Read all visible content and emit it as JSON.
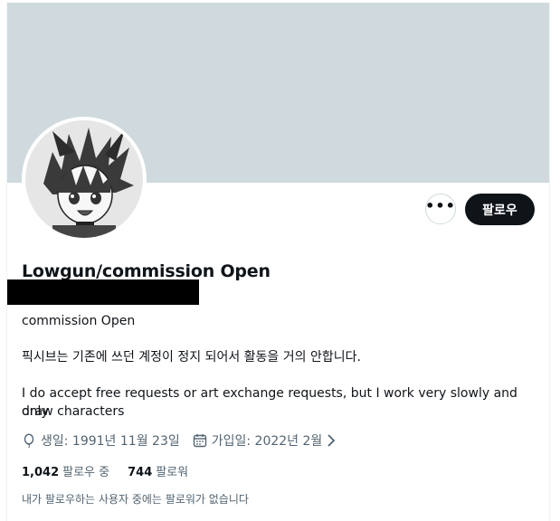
{
  "profile": {
    "display_name": "Lowgun/commission Open",
    "bio_line1": "commission Open",
    "bio_line2": "픽시브는 기존에 쓰던 계정이 정지 되어서 활동을 거의 안합니다.",
    "bio_line3": "I do accept free requests or art exchange requests, but I work very slowly and only",
    "bio_line4": "draw characters"
  },
  "actions": {
    "more_label": "•••",
    "follow_label": "팔로우"
  },
  "meta": {
    "birthday": "생일: 1991년 11월 23일",
    "joined": "가입일: 2022년 2월",
    "icons": [
      "balloon-icon",
      "calendar-icon",
      "chevron-right-icon"
    ]
  },
  "stats": {
    "following_count": "1,042",
    "following_label": "팔로우 중",
    "followers_count": "744",
    "followers_label": "팔로워"
  },
  "mutual_text": "내가 팔로우하는 사용자 중에는 팔로워가 없습니다",
  "colors": {
    "banner": "#cfd9de",
    "button_dark": "#0f1419",
    "secondary_text": "#536471"
  }
}
